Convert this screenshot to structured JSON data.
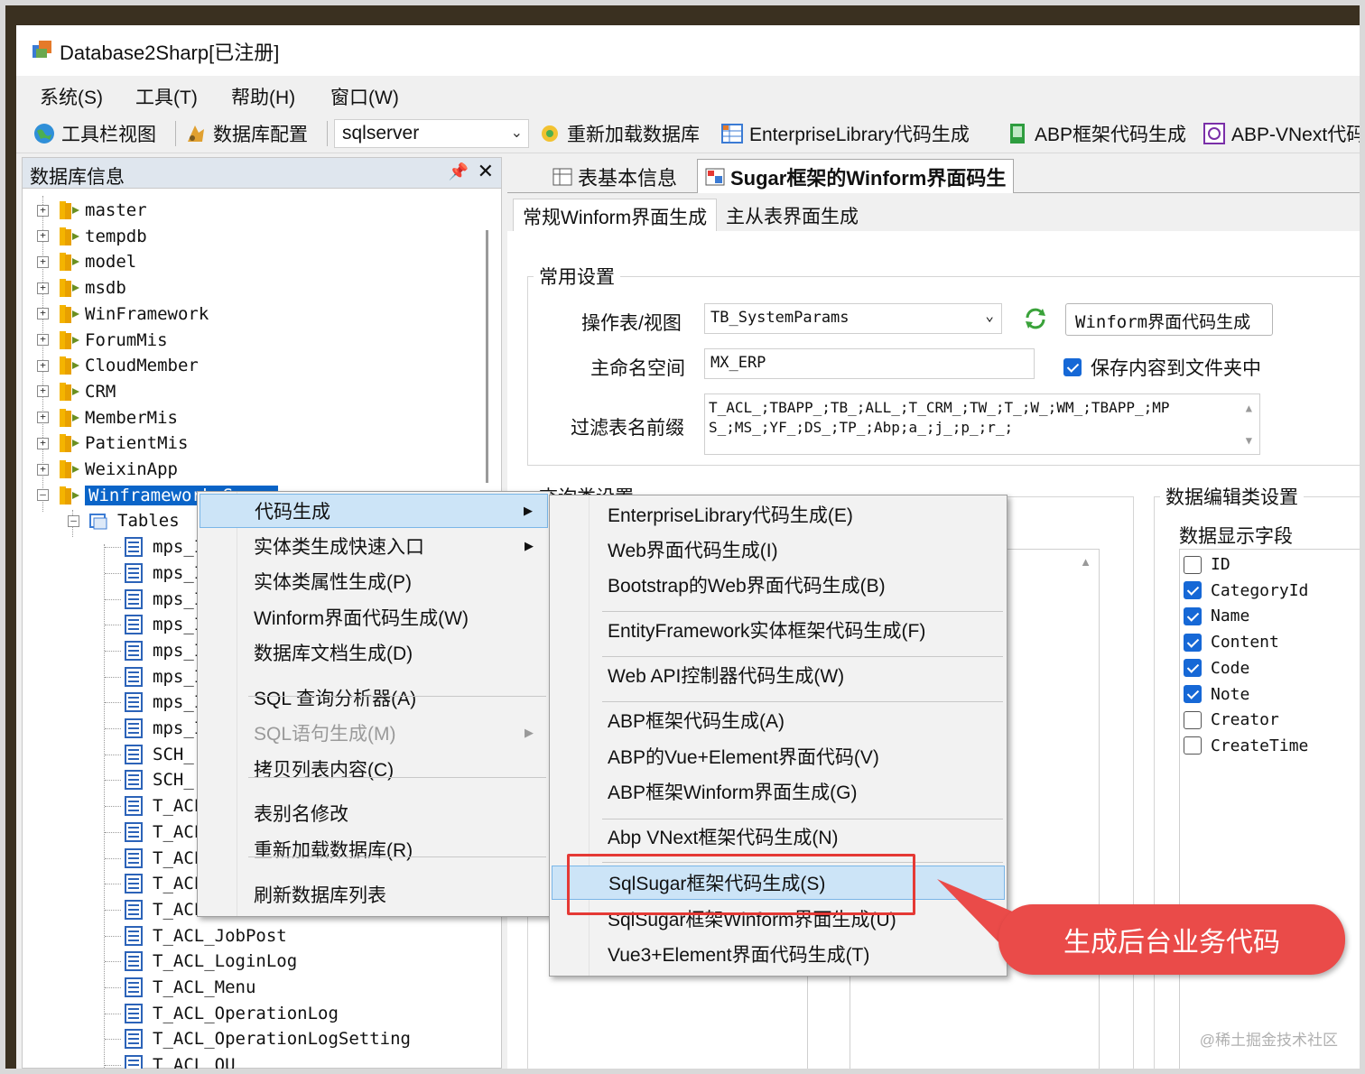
{
  "window": {
    "title": "Database2Sharp[已注册]"
  },
  "menubar": [
    "系统(S)",
    "工具(T)",
    "帮助(H)",
    "窗口(W)"
  ],
  "toolbar": {
    "toolbar_view": "工具栏视图",
    "db_config": "数据库配置",
    "db_type": "sqlserver",
    "reload_db": "重新加载数据库",
    "entlib_gen": "EnterpriseLibrary代码生成",
    "abp_gen": "ABP框架代码生成",
    "abp_vnext": "ABP-VNext代码"
  },
  "left_panel": {
    "title": "数据库信息",
    "databases": [
      "master",
      "tempdb",
      "model",
      "msdb",
      "WinFramework",
      "ForumMis",
      "CloudMember",
      "CRM",
      "MemberMis",
      "PatientMis",
      "WeixinApp"
    ],
    "selected_db": "Winframework_Sugar",
    "tables_node": "Tables",
    "tables": [
      "mps_I",
      "mps_I",
      "mps_I",
      "mps_I",
      "mps_I",
      "mps_I",
      "mps_I",
      "mps_I",
      "SCH_",
      "SCH_",
      "T_ACL",
      "T_ACL",
      "T_ACL",
      "T_ACL",
      "T_ACL",
      "T_ACL_JobPost",
      "T_ACL_LoginLog",
      "T_ACL_Menu",
      "T_ACL_OperationLog",
      "T_ACL_OperationLogSetting",
      "T_ACL_OU"
    ]
  },
  "doc_tabs": [
    "表基本信息",
    "Sugar框架的Winform界面码生"
  ],
  "sub_tabs": [
    "常规Winform界面生成",
    "主从表界面生成"
  ],
  "common_settings": {
    "group_title": "常用设置",
    "table_label": "操作表/视图",
    "table_value": "TB_SystemParams",
    "generate_button": "Winform界面代码生成",
    "namespace_label": "主命名空间",
    "namespace_value": "MX_ERP",
    "save_to_folder": "保存内容到文件夹中",
    "filter_label": "过滤表名前缀",
    "filter_line1": "T_ACL_;TBAPP_;TB_;ALL_;T_CRM_;TW_;T_;W_;WM_;TBAPP_;MP",
    "filter_line2": "S_;MS_;YF_;DS_;TP_;Abp;a_;j_;p_;r_;"
  },
  "query_settings": {
    "group_title": "查询类设置"
  },
  "edit_settings": {
    "group_title": "数据编辑类设置",
    "fields_title": "数据显示字段",
    "fields": [
      {
        "name": "ID",
        "checked": false
      },
      {
        "name": "CategoryId",
        "checked": true
      },
      {
        "name": "Name",
        "checked": true
      },
      {
        "name": "Content",
        "checked": true
      },
      {
        "name": "Code",
        "checked": true
      },
      {
        "name": "Note",
        "checked": true
      },
      {
        "name": "Creator",
        "checked": false
      },
      {
        "name": "CreateTime",
        "checked": false
      }
    ]
  },
  "context_menu": [
    {
      "label": "代码生成",
      "submenu": true,
      "highlighted": true
    },
    {
      "label": "实体类生成快速入口",
      "submenu": true
    },
    {
      "label": "实体类属性生成(P)"
    },
    {
      "label": "Winform界面代码生成(W)"
    },
    {
      "label": "数据库文档生成(D)"
    },
    {
      "label": "SQL 查询分析器(A)"
    },
    {
      "label": "SQL语句生成(M)",
      "submenu": true,
      "disabled": true
    },
    {
      "label": "拷贝列表内容(C)"
    },
    {
      "label": "表别名修改"
    },
    {
      "label": "重新加载数据库(R)"
    },
    {
      "label": "刷新数据库列表"
    }
  ],
  "submenu": [
    {
      "label": "EnterpriseLibrary代码生成(E)"
    },
    {
      "label": "Web界面代码生成(I)"
    },
    {
      "label": "Bootstrap的Web界面代码生成(B)"
    },
    {
      "label": "EntityFramework实体框架代码生成(F)"
    },
    {
      "label": "Web API控制器代码生成(W)"
    },
    {
      "label": "ABP框架代码生成(A)"
    },
    {
      "label": "ABP的Vue+Element界面代码(V)"
    },
    {
      "label": "ABP框架Winform界面生成(G)"
    },
    {
      "label": "Abp VNext框架代码生成(N)"
    },
    {
      "label": "SqlSugar框架代码生成(S)",
      "highlighted": true
    },
    {
      "label": "SqlSugar框架Winform界面生成(U)"
    },
    {
      "label": "Vue3+Element界面代码生成(T)"
    }
  ],
  "callout": "生成后台业务代码",
  "watermark": "@稀土掘金技术社区",
  "colors": {
    "selection": "#0a64c8",
    "menu_highlight": "#cce4f7",
    "annotation_red": "#e53935",
    "callout_bg": "#ea4b49",
    "checkbox_blue": "#1668d6"
  }
}
